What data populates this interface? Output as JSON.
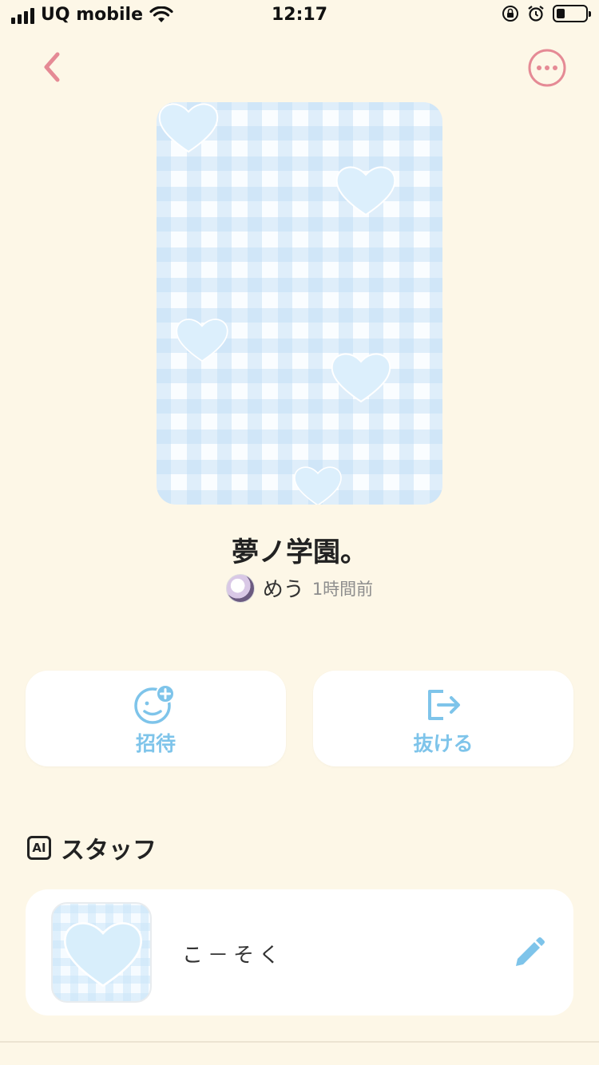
{
  "status_bar": {
    "carrier": "UQ mobile",
    "time": "12:17"
  },
  "header": {
    "back_icon": "chevron-left-icon",
    "more_icon": "more-dots-icon",
    "accent_color": "#E58A95"
  },
  "room": {
    "title": "夢ノ学園。",
    "owner_name": "めう",
    "posted_time": "1時間前"
  },
  "actions": [
    {
      "label": "招待",
      "icon": "invite-user-icon"
    },
    {
      "label": "抜ける",
      "icon": "leave-icon"
    }
  ],
  "staff_section": {
    "badge": "AI",
    "title": "スタッフ",
    "items": [
      {
        "name": "こ－そく",
        "edit_icon": "pencil-icon"
      }
    ]
  },
  "colors": {
    "background": "#FDF7E7",
    "action_blue": "#7EC4EA",
    "heart_blue": "#DCEFFC"
  }
}
